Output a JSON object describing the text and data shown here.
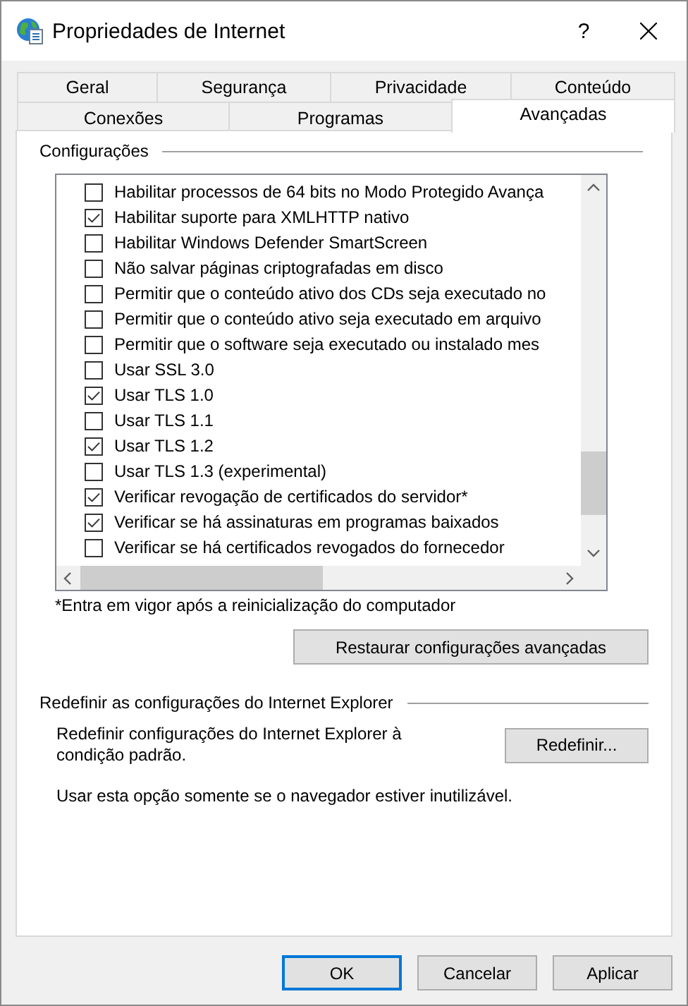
{
  "window": {
    "title": "Propriedades de Internet",
    "help": "?"
  },
  "tabs": [
    [
      {
        "label": "Geral",
        "selected": false
      },
      {
        "label": "Segurança",
        "selected": false
      },
      {
        "label": "Privacidade",
        "selected": false
      },
      {
        "label": "Conteúdo",
        "selected": false
      }
    ],
    [
      {
        "label": "Conexões",
        "selected": false
      },
      {
        "label": "Programas",
        "selected": false
      },
      {
        "label": "Avançadas",
        "selected": true
      }
    ]
  ],
  "settings": {
    "label": "Configurações",
    "items": [
      {
        "label": "Habilitar processos de 64 bits no Modo Protegido Avança",
        "checked": false
      },
      {
        "label": "Habilitar suporte para XMLHTTP nativo",
        "checked": true
      },
      {
        "label": "Habilitar Windows Defender SmartScreen",
        "checked": false
      },
      {
        "label": "Não salvar páginas criptografadas em disco",
        "checked": false
      },
      {
        "label": "Permitir que o conteúdo ativo dos CDs seja executado no",
        "checked": false
      },
      {
        "label": "Permitir que o conteúdo ativo seja executado em arquivo",
        "checked": false
      },
      {
        "label": "Permitir que o software seja executado ou instalado mes",
        "checked": false
      },
      {
        "label": "Usar SSL 3.0",
        "checked": false
      },
      {
        "label": "Usar TLS 1.0",
        "checked": true
      },
      {
        "label": "Usar TLS 1.1",
        "checked": false
      },
      {
        "label": "Usar TLS 1.2",
        "checked": true
      },
      {
        "label": "Usar TLS 1.3 (experimental)",
        "checked": false
      },
      {
        "label": "Verificar revogação de certificados do servidor*",
        "checked": true
      },
      {
        "label": "Verificar se há assinaturas em programas baixados",
        "checked": true
      },
      {
        "label": "Verificar se há certificados revogados do fornecedor",
        "checked": false
      }
    ],
    "footnote": "*Entra em vigor após a reinicialização do computador",
    "restore_button": "Restaurar configurações avançadas"
  },
  "reset": {
    "label": "Redefinir as configurações do Internet Explorer",
    "description": "Redefinir configurações do Internet Explorer à condição padrão.",
    "button": "Redefinir...",
    "note": "Usar esta opção somente se o navegador estiver inutilizável."
  },
  "buttons": [
    {
      "label": "OK",
      "default": true
    },
    {
      "label": "Cancelar",
      "default": false
    },
    {
      "label": "Aplicar",
      "default": false
    }
  ]
}
